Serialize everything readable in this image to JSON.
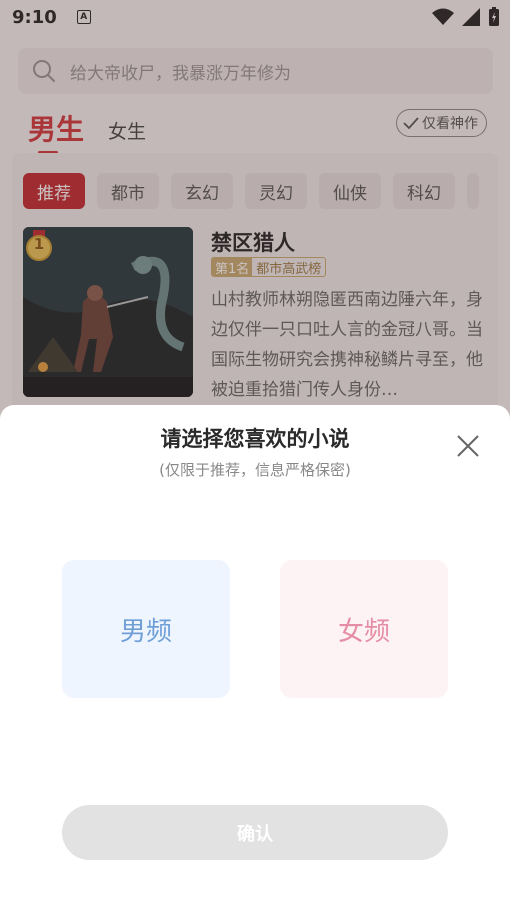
{
  "status": {
    "time": "9:10"
  },
  "search": {
    "placeholder": "给大帝收尸，我暴涨万年修为"
  },
  "gender_tabs": {
    "male": "男生",
    "female": "女生"
  },
  "filter": {
    "only_god_works": "仅看神作"
  },
  "categories": [
    "推荐",
    "都市",
    "玄幻",
    "灵幻",
    "仙侠",
    "科幻"
  ],
  "book": {
    "rank": "1",
    "title": "禁区猎人",
    "rank_tag": "第1名",
    "list_tag": "都市高武榜",
    "description": "山村教师林朔隐匿西南边陲六年，身边仅伴一只口吐人言的金冠八哥。当国际生物研究会携神秘鳞片寻至，他被迫重拾猎门传人身份…"
  },
  "modal": {
    "title": "请选择您喜欢的小说",
    "subtitle": "(仅限于推荐，信息严格保密)",
    "male_option": "男频",
    "female_option": "女频",
    "confirm": "确认"
  },
  "colors": {
    "accent_red": "#c0282d",
    "male_blue": "#6f9fd6",
    "female_pink": "#e58ca6"
  }
}
